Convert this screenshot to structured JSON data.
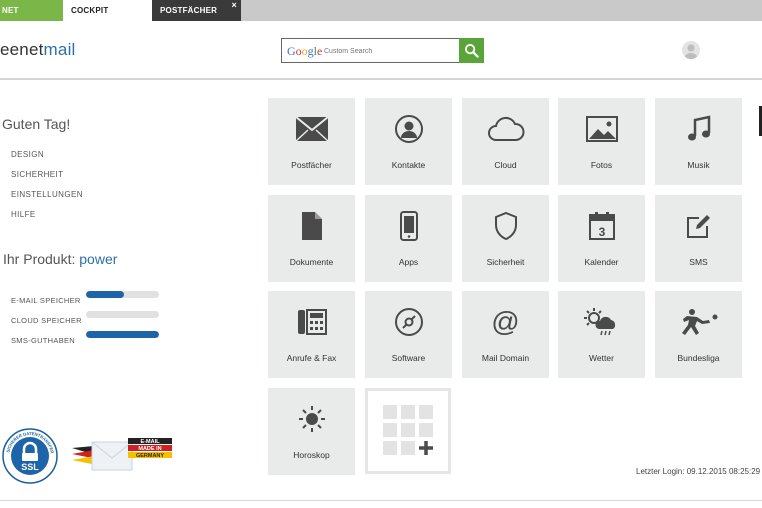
{
  "tabs": [
    {
      "label": "NET"
    },
    {
      "label": "COCKPIT"
    },
    {
      "label": "POSTFÄCHER",
      "close": "×"
    }
  ],
  "header": {
    "logo_prefix": "eenet",
    "logo_suffix": "mail",
    "search": {
      "google_word": [
        "G",
        "o",
        "o",
        "g",
        "l",
        "e"
      ],
      "placeholder": "Custom Search",
      "button_icon": "search-icon"
    },
    "avatar_icon": "user-avatar-icon"
  },
  "sidebar": {
    "greeting": "Guten Tag!",
    "menu": [
      "DESIGN",
      "SICHERHEIT",
      "EINSTELLUNGEN",
      "HILFE"
    ],
    "product_label": "Ihr Produkt:",
    "product_value": "power",
    "usage": [
      {
        "label": "E-MAIL SPEICHER",
        "fill_fraction": 0.52
      },
      {
        "label": "CLOUD SPEICHER",
        "fill_fraction": 0.0
      },
      {
        "label": "SMS-GUTHABEN",
        "fill_fraction": 1.0
      }
    ],
    "ssl_badge": {
      "text": "SSL",
      "ring_text": "SICHERER DATENTRANSFER"
    },
    "made_badge": {
      "lines": [
        "E-MAIL",
        "MADE IN",
        "GERMANY"
      ]
    }
  },
  "tiles": [
    {
      "label": "Postfächer",
      "icon": "envelope-icon"
    },
    {
      "label": "Kontakte",
      "icon": "contact-icon"
    },
    {
      "label": "Cloud",
      "icon": "cloud-icon"
    },
    {
      "label": "Fotos",
      "icon": "photo-icon"
    },
    {
      "label": "Musik",
      "icon": "music-icon"
    },
    {
      "label": "Dokumente",
      "icon": "document-icon"
    },
    {
      "label": "Apps",
      "icon": "phone-icon"
    },
    {
      "label": "Sicherheit",
      "icon": "shield-icon"
    },
    {
      "label": "Kalender",
      "icon": "calendar-icon",
      "icon_text": "3"
    },
    {
      "label": "SMS",
      "icon": "edit-icon"
    },
    {
      "label": "Anrufe & Fax",
      "icon": "fax-icon"
    },
    {
      "label": "Software",
      "icon": "disc-icon"
    },
    {
      "label": "Mail Domain",
      "icon": "at-icon",
      "icon_text": "@"
    },
    {
      "label": "Wetter",
      "icon": "weather-icon"
    },
    {
      "label": "Bundesliga",
      "icon": "football-icon"
    },
    {
      "label": "Horoskop",
      "icon": "sun-icon"
    }
  ],
  "add_tile": {
    "icon": "add-app-icon"
  },
  "footer": {
    "last_login": "Letzter Login: 09.12.2015 08:25:29"
  },
  "colors": {
    "accent": "#2d6ea8",
    "green": "#5aa53a",
    "tile_bg": "#e9ebea",
    "bar_fill": "#1e64a8"
  }
}
